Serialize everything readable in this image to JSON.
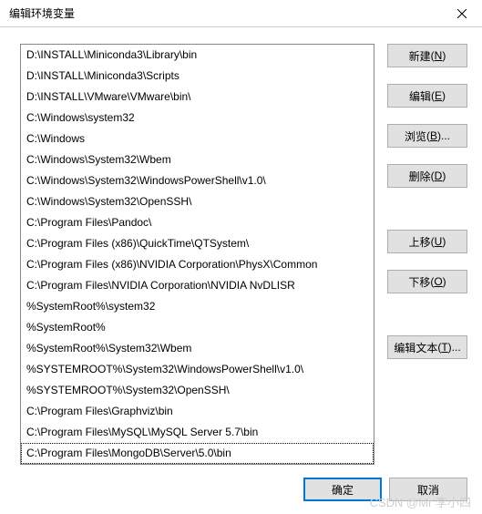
{
  "window": {
    "title": "编辑环境变量"
  },
  "list": {
    "items": [
      "D:\\INSTALL\\Miniconda3\\Library\\bin",
      "D:\\INSTALL\\Miniconda3\\Scripts",
      "D:\\INSTALL\\VMware\\VMware\\bin\\",
      "C:\\Windows\\system32",
      "C:\\Windows",
      "C:\\Windows\\System32\\Wbem",
      "C:\\Windows\\System32\\WindowsPowerShell\\v1.0\\",
      "C:\\Windows\\System32\\OpenSSH\\",
      "C:\\Program Files\\Pandoc\\",
      "C:\\Program Files (x86)\\QuickTime\\QTSystem\\",
      "C:\\Program Files (x86)\\NVIDIA Corporation\\PhysX\\Common",
      "C:\\Program Files\\NVIDIA Corporation\\NVIDIA NvDLISR",
      "%SystemRoot%\\system32",
      "%SystemRoot%",
      "%SystemRoot%\\System32\\Wbem",
      "%SYSTEMROOT%\\System32\\WindowsPowerShell\\v1.0\\",
      "%SYSTEMROOT%\\System32\\OpenSSH\\",
      "C:\\Program Files\\Graphviz\\bin",
      "C:\\Program Files\\MySQL\\MySQL Server 5.7\\bin",
      "C:\\Program Files\\MongoDB\\Server\\5.0\\bin"
    ],
    "selected_index": 19
  },
  "buttons": {
    "new": {
      "label": "新建",
      "mnemonic": "N"
    },
    "edit": {
      "label": "编辑",
      "mnemonic": "E"
    },
    "browse": {
      "label": "浏览",
      "mnemonic": "B",
      "suffix": "..."
    },
    "delete": {
      "label": "删除",
      "mnemonic": "D"
    },
    "move_up": {
      "label": "上移",
      "mnemonic": "U"
    },
    "move_down": {
      "label": "下移",
      "mnemonic": "O"
    },
    "edit_text": {
      "label": "编辑文本",
      "mnemonic": "T",
      "suffix": "..."
    },
    "ok": {
      "label": "确定"
    },
    "cancel": {
      "label": "取消"
    }
  },
  "watermark": "CSDN @Mr 李小四"
}
